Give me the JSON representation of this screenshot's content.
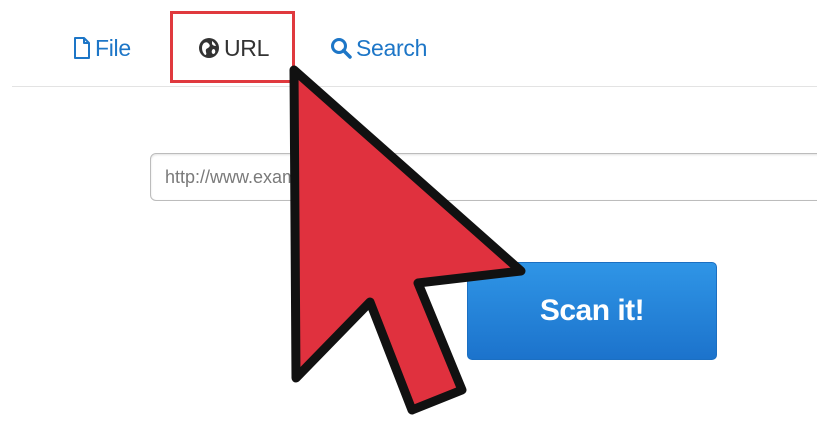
{
  "tabs": [
    {
      "label": "File",
      "icon": "file-icon"
    },
    {
      "label": "URL",
      "icon": "globe-icon"
    },
    {
      "label": "Search",
      "icon": "search-icon"
    }
  ],
  "selected_tab": "URL",
  "url_input": {
    "placeholder": "http://www.example.com",
    "value": ""
  },
  "scan_button": {
    "label": "Scan it!"
  },
  "colors": {
    "link": "#1d76c7",
    "button": "#2284d8",
    "highlight": "#e0393e",
    "cursor": "#e0313e"
  }
}
